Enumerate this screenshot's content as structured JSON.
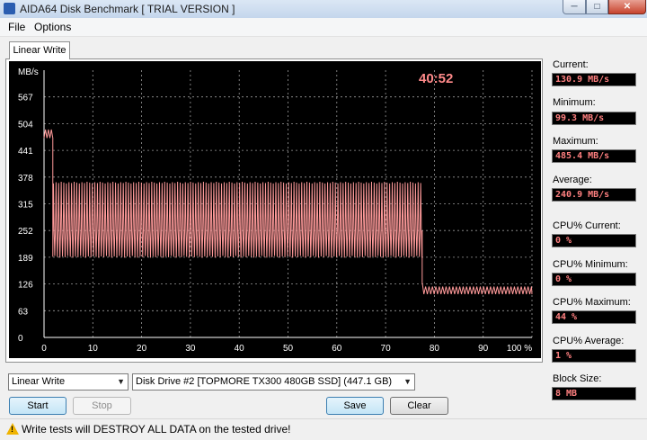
{
  "window": {
    "title": "AIDA64 Disk Benchmark  [ TRIAL VERSION ]"
  },
  "menu": [
    "File",
    "Options"
  ],
  "tab": {
    "label": "Linear Write"
  },
  "chart_data": {
    "type": "line",
    "timer": "40:52",
    "ylabel": "MB/s",
    "ylim": [
      0,
      630
    ],
    "xlim": [
      0,
      100
    ],
    "y_ticks": [
      "0",
      "63",
      "126",
      "189",
      "252",
      "315",
      "378",
      "441",
      "504",
      "567"
    ],
    "x_ticks": [
      "0",
      "10",
      "20",
      "30",
      "40",
      "50",
      "60",
      "70",
      "80",
      "90",
      "100 %"
    ],
    "grid": true,
    "line_color": "#ff9a9a",
    "segments": [
      {
        "x_from": 0,
        "x_to": 1.8,
        "low": 470,
        "high": 490
      },
      {
        "x_from": 1.8,
        "x_to": 77.5,
        "low": 190,
        "high": 365,
        "mid": 252
      },
      {
        "x_from": 77.5,
        "x_to": 100,
        "low": 99,
        "high": 130
      }
    ]
  },
  "stats": {
    "current": {
      "label": "Current:",
      "value": "130.9 MB/s"
    },
    "minimum": {
      "label": "Minimum:",
      "value": "99.3 MB/s"
    },
    "maximum": {
      "label": "Maximum:",
      "value": "485.4 MB/s"
    },
    "average": {
      "label": "Average:",
      "value": "240.9 MB/s"
    },
    "cpu_current": {
      "label": "CPU% Current:",
      "value": "0 %"
    },
    "cpu_minimum": {
      "label": "CPU% Minimum:",
      "value": "0 %"
    },
    "cpu_maximum": {
      "label": "CPU% Maximum:",
      "value": "44 %"
    },
    "cpu_average": {
      "label": "CPU% Average:",
      "value": "1 %"
    },
    "block_size": {
      "label": "Block Size:",
      "value": "8 MB"
    }
  },
  "controls": {
    "test_select": "Linear Write",
    "drive_select": "Disk Drive #2  [TOPMORE TX300 480GB SSD]  (447.1 GB)",
    "start": "Start",
    "stop": "Stop",
    "save": "Save",
    "clear": "Clear"
  },
  "status": {
    "warning": "Write tests will DESTROY ALL DATA on the tested drive!"
  }
}
